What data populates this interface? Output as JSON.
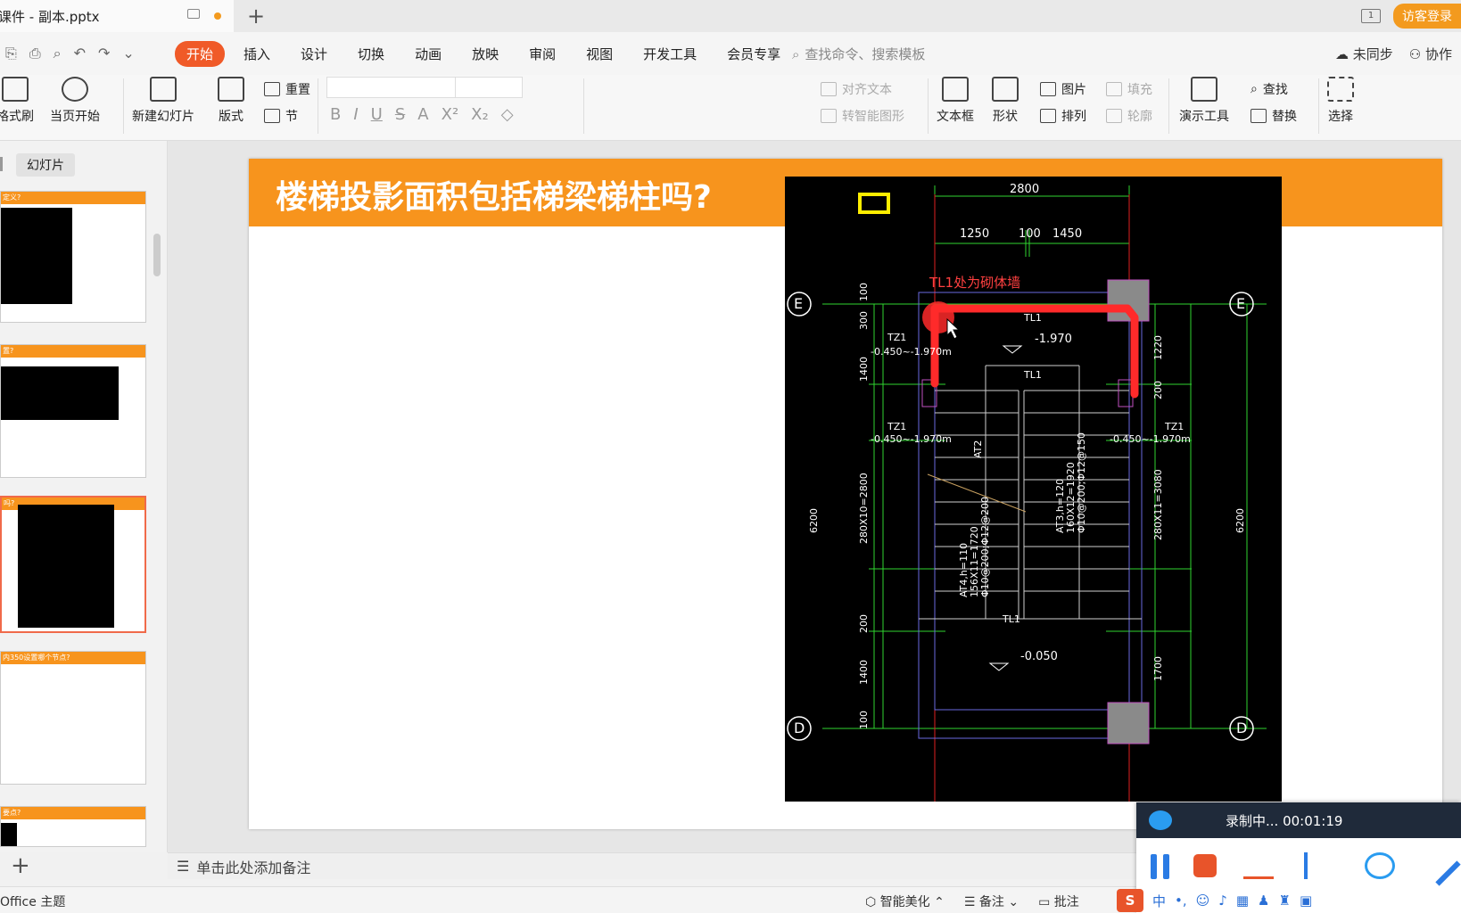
{
  "titlebar": {
    "doc_title": "课件 - 副本.pptx",
    "login": "访客登录"
  },
  "menu": {
    "tabs": [
      "开始",
      "插入",
      "设计",
      "切换",
      "动画",
      "放映",
      "审阅",
      "视图",
      "开发工具",
      "会员专享"
    ],
    "search_placeholder": "查找命令、搜索模板",
    "unsynced": "未同步",
    "collab": "协作"
  },
  "ribbon": {
    "format_brush": "格式刷",
    "from_current": "当页开始",
    "new_slide": "新建幻灯片",
    "layout": "版式",
    "reset": "重置",
    "section": "节",
    "align_text": "对齐文本",
    "to_smartart": "转智能图形",
    "textbox": "文本框",
    "shape": "形状",
    "picture": "图片",
    "fill": "填充",
    "arrange": "排列",
    "outline": "轮廓",
    "present_tools": "演示工具",
    "find": "查找",
    "replace": "替换",
    "select": "选择"
  },
  "left_panel": {
    "tab_outline": "",
    "tab_slides": "幻灯片",
    "thumbs": [
      {
        "title": "定义?"
      },
      {
        "title": "置?"
      },
      {
        "title": "吗?"
      },
      {
        "title": "内350设置哪个节点?"
      },
      {
        "title": "要点?"
      }
    ]
  },
  "slide": {
    "title": "楼梯投影面积包括梯梁梯柱吗?"
  },
  "cad": {
    "dims_top": [
      "2800",
      "1250",
      "100",
      "1450"
    ],
    "note": "TL1处为砌体墙",
    "grid_labels": [
      "E",
      "D"
    ],
    "labels": [
      "TL1",
      "TZ1",
      "AT2",
      "-1.970",
      "-0.050",
      "-0.450~-1.970m"
    ],
    "left_dims": [
      "100",
      "300",
      "1400",
      "280X10=2800",
      "200",
      "1400",
      "100",
      "6200"
    ],
    "right_dims": [
      "1220",
      "200",
      "280X11=3080",
      "1700",
      "6200"
    ],
    "at3": "AT3,h=120",
    "at3b": "160X12=1920",
    "at3c": "Φ10@200;Φ12@150",
    "at4": "AT4,h=110",
    "at4b": "156X11=1720",
    "at4c": "Φ10@200;Φ12@200"
  },
  "notes": {
    "placeholder": "单击此处添加备注"
  },
  "status": {
    "theme": "Office 主题",
    "beautify": "智能美化",
    "notes": "备注",
    "comment": "批注"
  },
  "recorder": {
    "status": "录制中... 00:01:19"
  },
  "ime": {
    "mode": "中"
  }
}
